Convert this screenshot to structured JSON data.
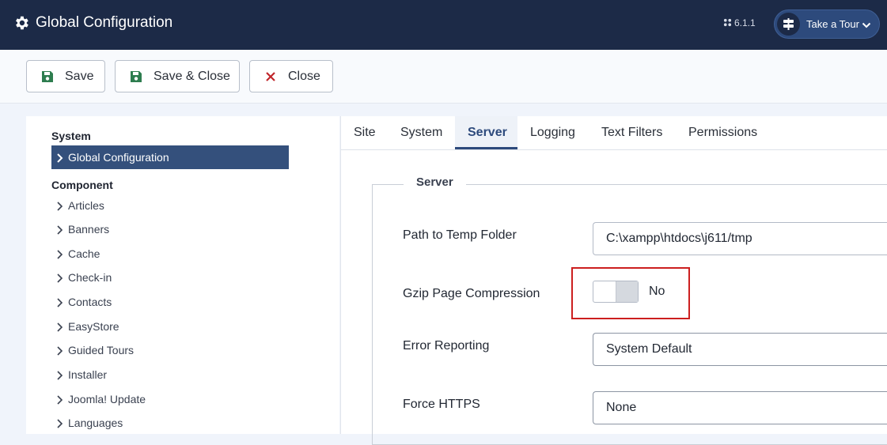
{
  "header": {
    "title": "Global Configuration",
    "icon": "gear-icon",
    "version": "6.1.1",
    "tour_label": "Take a Tour"
  },
  "toolbar": {
    "save_label": "Save",
    "save_close_label": "Save & Close",
    "close_label": "Close"
  },
  "sidebar": {
    "system_heading": "System",
    "active_item": "Global Configuration",
    "component_heading": "Component",
    "items": [
      {
        "label": "Articles"
      },
      {
        "label": "Banners"
      },
      {
        "label": "Cache"
      },
      {
        "label": "Check-in"
      },
      {
        "label": "Contacts"
      },
      {
        "label": "EasyStore"
      },
      {
        "label": "Guided Tours"
      },
      {
        "label": "Installer"
      },
      {
        "label": "Joomla! Update"
      },
      {
        "label": "Languages"
      }
    ]
  },
  "tabs": [
    {
      "label": "Site"
    },
    {
      "label": "System"
    },
    {
      "label": "Server",
      "active": true
    },
    {
      "label": "Logging"
    },
    {
      "label": "Text Filters"
    },
    {
      "label": "Permissions"
    }
  ],
  "server": {
    "legend": "Server",
    "temp_folder_label": "Path to Temp Folder",
    "temp_folder_value": "C:\\xampp\\htdocs\\j611/tmp",
    "gzip_label": "Gzip Page Compression",
    "gzip_value": "No",
    "error_reporting_label": "Error Reporting",
    "error_reporting_value": "System Default",
    "force_https_label": "Force HTTPS",
    "force_https_value": "None"
  },
  "colors": {
    "header_bg": "#1c2a47",
    "accent": "#2d4a7c",
    "save_icon": "#2e7d4f",
    "close_icon": "#c0252a",
    "highlight": "#cc1f1f"
  }
}
